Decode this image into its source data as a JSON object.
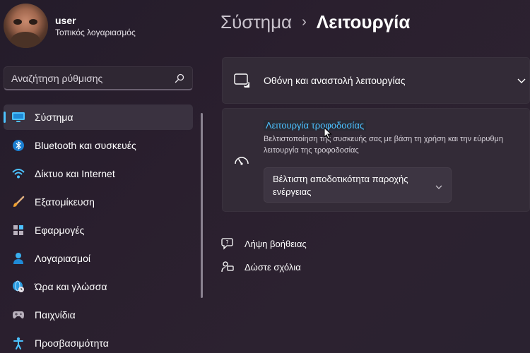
{
  "profile": {
    "name": "user",
    "account_type": "Τοπικός λογαριασμός"
  },
  "search": {
    "placeholder": "Αναζήτηση ρύθμισης"
  },
  "sidebar": {
    "items": [
      {
        "label": "Σύστημα",
        "icon": "monitor-icon",
        "active": true
      },
      {
        "label": "Bluetooth και συσκευές",
        "icon": "bluetooth-icon"
      },
      {
        "label": "Δίκτυο και Internet",
        "icon": "wifi-icon"
      },
      {
        "label": "Εξατομίκευση",
        "icon": "brush-icon"
      },
      {
        "label": "Εφαρμογές",
        "icon": "apps-icon"
      },
      {
        "label": "Λογαριασμοί",
        "icon": "person-icon"
      },
      {
        "label": "Ώρα και γλώσσα",
        "icon": "globe-clock-icon"
      },
      {
        "label": "Παιχνίδια",
        "icon": "gamepad-icon"
      },
      {
        "label": "Προσβασιμότητα",
        "icon": "accessibility-icon"
      }
    ]
  },
  "breadcrumb": {
    "parent": "Σύστημα",
    "separator": "›",
    "current": "Λειτουργία"
  },
  "cards": {
    "display_sleep": {
      "title": "Οθόνη και αναστολή λειτουργίας"
    },
    "power_mode": {
      "title": "Λειτουργία τροφοδοσίας",
      "description": "Βελτιστοποίηση της συσκευής σας με βάση τη χρήση και την εύρυθμη λειτουργία της τροφοδοσίας",
      "selected_value": "Βέλτιστη αποδοτικότητα παροχής ενέργειας"
    }
  },
  "links": {
    "help": "Λήψη βοήθειας",
    "feedback": "Δώστε σχόλια"
  },
  "colors": {
    "accent": "#4cc2ff",
    "background": "#2a1f2e",
    "card": "#332b37"
  }
}
